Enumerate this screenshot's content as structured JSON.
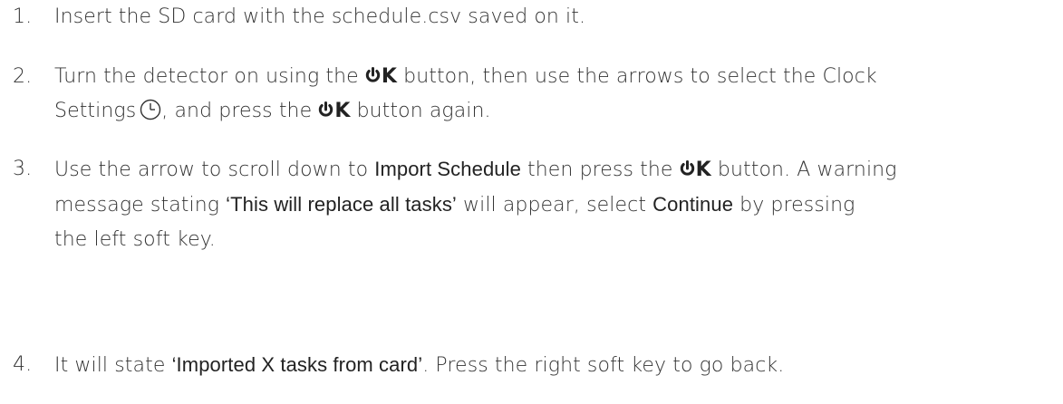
{
  "steps": [
    {
      "number": "1.",
      "text": "Insert the SD card with the schedule.csv saved on it."
    },
    {
      "number": "2.",
      "line1_a": "Turn the detector on using the ",
      "ok_suffix": "K",
      "line1_b": " button, then use the arrows to select the Clock",
      "line2_a": "Settings",
      "line2_b": ", and press the ",
      "line2_c": " button again."
    },
    {
      "number": "3.",
      "line1_a": "Use the arrow to scroll down to ",
      "line1_emph": "Import Schedule",
      "line1_b": " then press the ",
      "line1_c": " button. A warning",
      "line2_a": "message stating ",
      "line2_emph": "‘This will replace all tasks’",
      "line2_b": " will appear, select ",
      "line2_emph2": "Continue",
      "line2_c": " by pressing",
      "line3": "the left soft key."
    },
    {
      "number": "4.",
      "line1_a": "It will state ",
      "line1_emph": "‘Imported X tasks from card’",
      "line1_b": ". Press the right soft key to go back."
    }
  ],
  "icons": {
    "power": "power-icon",
    "clock": "clock-icon"
  }
}
